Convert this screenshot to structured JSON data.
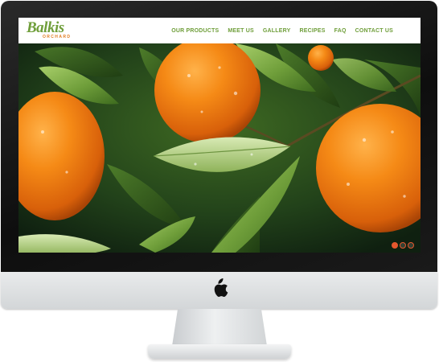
{
  "site": {
    "logo": {
      "name": "Balkis",
      "subtitle": "ORCHARD"
    },
    "nav": [
      {
        "label": "OUR PRODUCTS"
      },
      {
        "label": "MEET US"
      },
      {
        "label": "GALLERY"
      },
      {
        "label": "RECIPES"
      },
      {
        "label": "FAQ"
      },
      {
        "label": "CONTACT US"
      }
    ],
    "carousel": {
      "slide_count": 3,
      "active_index": 0
    }
  },
  "colors": {
    "brand_green": "#6f9e3a",
    "brand_orange": "#e07a1d",
    "carousel_dot": "#e4572e"
  },
  "icons": {
    "device_logo": "apple-logo-icon"
  }
}
